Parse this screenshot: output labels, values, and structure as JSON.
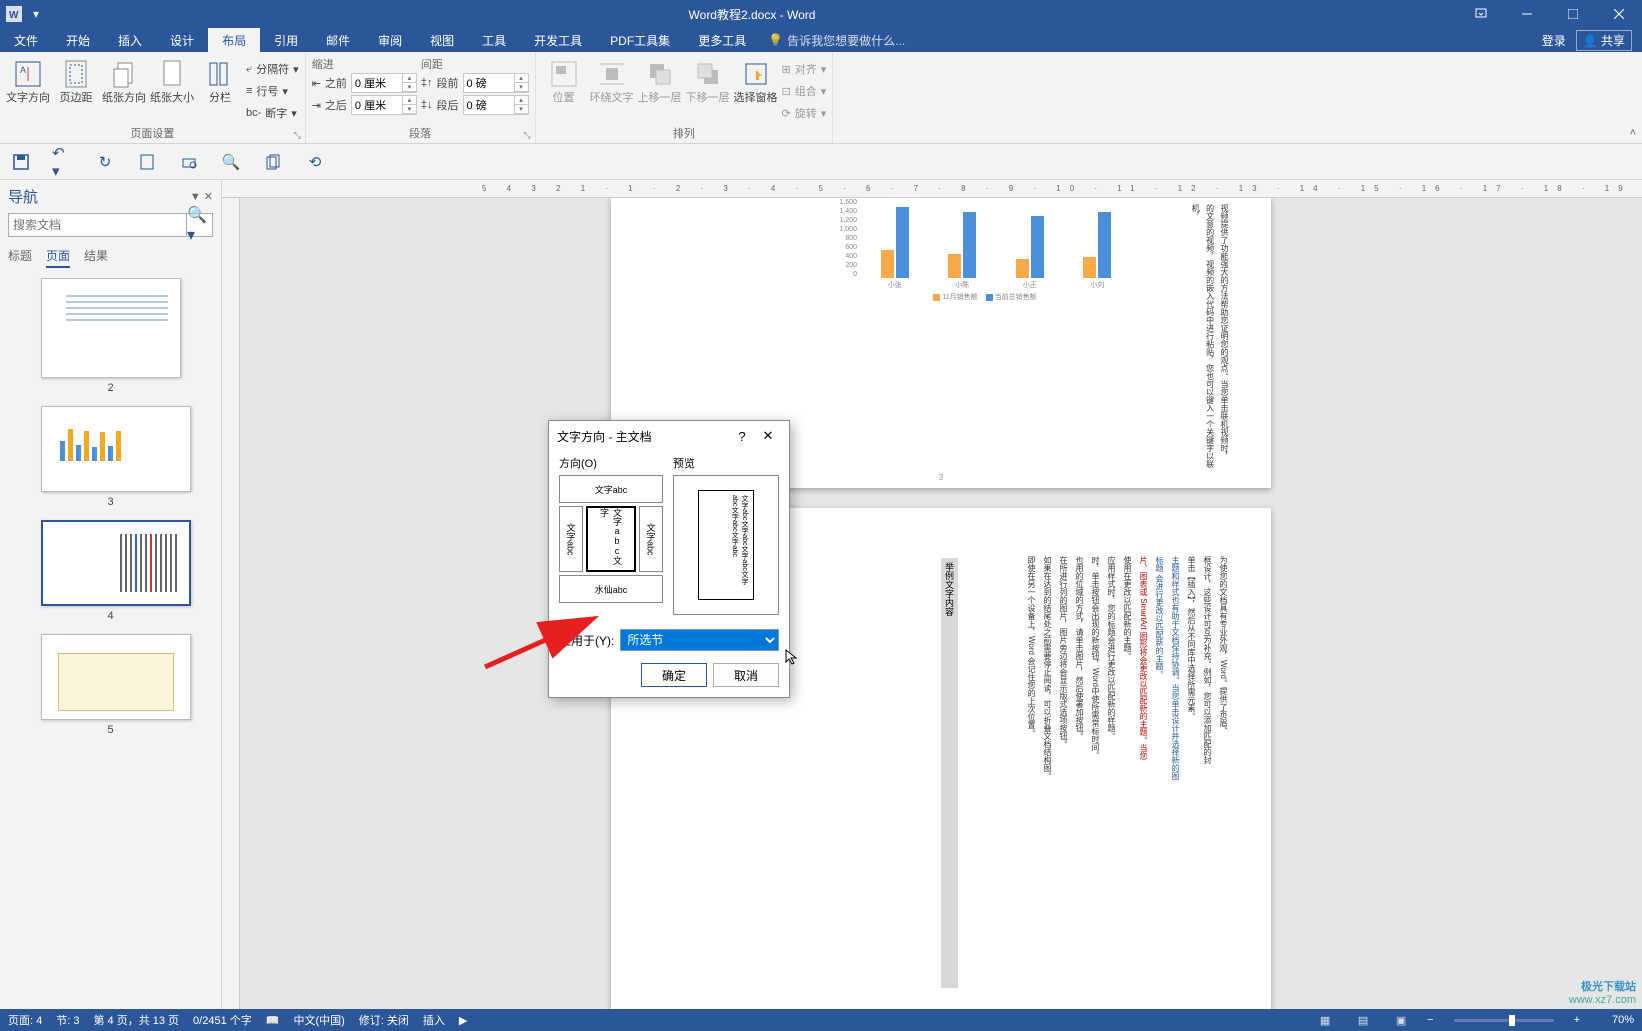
{
  "window": {
    "title": "Word教程2.docx - Word"
  },
  "tabs": {
    "file": "文件",
    "home": "开始",
    "insert": "插入",
    "design": "设计",
    "layout": "布局",
    "references": "引用",
    "mailings": "邮件",
    "review": "审阅",
    "view": "视图",
    "tools": "工具",
    "devtools": "开发工具",
    "pdftools": "PDF工具集",
    "moretools": "更多工具",
    "tellme": "告诉我您想要做什么...",
    "login": "登录",
    "share": "共享"
  },
  "ribbon": {
    "page_setup": {
      "label": "页面设置",
      "text_direction": "文字方向",
      "margins": "页边距",
      "orientation": "纸张方向",
      "size": "纸张大小",
      "columns": "分栏",
      "breaks": "分隔符",
      "line_numbers": "行号",
      "hyphenation": "断字"
    },
    "paragraph": {
      "label": "段落",
      "indent_title": "缩进",
      "spacing_title": "间距",
      "indent_left_label": "之前",
      "indent_right_label": "之后",
      "spacing_before_label": "段前",
      "spacing_after_label": "段后",
      "indent_left": "0 厘米",
      "indent_right": "0 厘米",
      "spacing_before": "0 磅",
      "spacing_after": "0 磅"
    },
    "arrange": {
      "label": "排列",
      "position": "位置",
      "wrap": "环绕文字",
      "bring_forward": "上移一层",
      "send_backward": "下移一层",
      "selection_pane": "选择窗格",
      "align": "对齐",
      "group": "组合",
      "rotate": "旋转"
    }
  },
  "nav": {
    "title": "导航",
    "search_placeholder": "搜索文档",
    "tabs": {
      "headings": "标题",
      "pages": "页面",
      "results": "结果"
    },
    "thumbs": [
      "2",
      "3",
      "4",
      "5"
    ]
  },
  "dialog": {
    "title": "文字方向 - 主文档",
    "orientation_label": "方向(O)",
    "preview_label": "预览",
    "sample_h": "文字abc",
    "sample_v": "文字abc文字",
    "sample_v2": "文字abc",
    "sample_v3": "文字abc",
    "sample_bottom": "水仙abc",
    "preview_text": "文字abc文字abc文字abc文字abc文字abc文字abc",
    "apply_label": "应用于(Y):",
    "apply_value": "所选节",
    "ok": "确定",
    "cancel": "取消"
  },
  "chart_data": {
    "type": "bar",
    "categories": [
      "小张",
      "小陈",
      "小王",
      "小刘"
    ],
    "series": [
      {
        "name": "11月销售额",
        "values": [
          600,
          500,
          400,
          450
        ]
      },
      {
        "name": "当前总销售额",
        "values": [
          1500,
          1400,
          1300,
          1400
        ]
      }
    ],
    "ylim": [
      0,
      1600
    ],
    "yticks": [
      0,
      200,
      400,
      600,
      800,
      1000,
      1200,
      1400,
      1600
    ],
    "xlabel": "",
    "ylabel": "",
    "legend": [
      "11月销售额",
      "当前总销售额"
    ]
  },
  "doc": {
    "page2_vtext": "的文意的视频，视频的嵌入代码中进行粘贴，您也可以键入一个关键字以联机，",
    "page2_vtext2": "视频提供了功能强大的方法帮助您证明您的观点。当您单击联机视频时，",
    "page3_num": "3",
    "page3_highlight": "举例文字内容",
    "page3_body_lines": [
      "为使您的文档具有专业外观，Word。提供了页眉、",
      "框设计，这些设计可互为补充。例如，您可以添加匹配的封",
      "单击【插入】，然后从不同库中选择所需元素。",
      "主题和样式也有助于文档保持协调。当您单击设计并选择新的图",
      "标题 会进行更改以匹配新的主题。",
      "片、图表或 SmartArt 图形将会更改以匹配新的主题。当您",
      "使用在更改以匹配新的主题。",
      "应用样式时，您的标题会进行更改以匹配新的样题。",
      "时，单击按钮会出现的新按钮，Word中使所需常标时间。",
      "也用的位域的方式，请单击图片，然后使署加按钮。",
      "在所进行列的图片，图片旁边将会显示版式选项按钮。",
      "如果在达到的结尾处之前需要停止阅读，可以折叠文档结构图。",
      "即使在另一个设备上，Word 会记住您的上次位置。"
    ]
  },
  "status": {
    "page": "页面: 4",
    "section": "节: 3",
    "page_of": "第 4 页，共 13 页",
    "words": "0/2451 个字",
    "lang": "中文(中国)",
    "track": "修订: 关闭",
    "insert": "插入",
    "zoom": "70%"
  },
  "watermark": {
    "l1": "极光下载站",
    "l2": "www.xz7.com"
  }
}
